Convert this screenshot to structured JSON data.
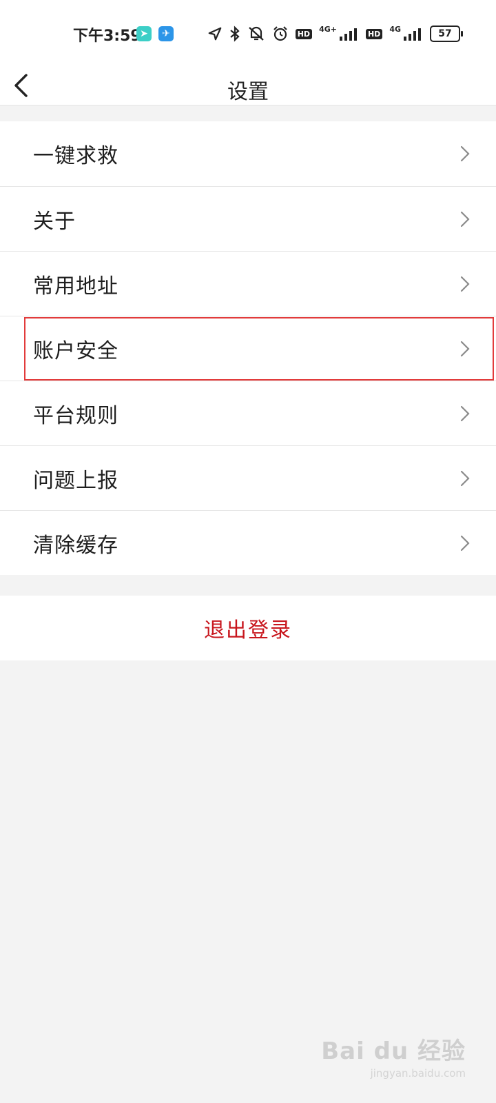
{
  "status_bar": {
    "time": "下午3:59",
    "network_1": "4G+",
    "network_2": "4G",
    "hd_label": "HD",
    "battery": "57",
    "icons": [
      "location-icon",
      "bluetooth-icon",
      "mute-icon",
      "alarm-icon",
      "signal-icon",
      "battery-icon"
    ]
  },
  "header": {
    "title": "设置"
  },
  "settings": {
    "items": [
      {
        "label": "一键求救"
      },
      {
        "label": "关于"
      },
      {
        "label": "常用地址"
      },
      {
        "label": "账户安全"
      },
      {
        "label": "平台规则"
      },
      {
        "label": "问题上报"
      },
      {
        "label": "清除缓存"
      }
    ],
    "highlighted_item": "账户安全"
  },
  "logout": {
    "label": "退出登录",
    "color": "#c8161d"
  },
  "watermark": {
    "brand": "Bai du 经验",
    "url": "jingyan.baidu.com"
  }
}
